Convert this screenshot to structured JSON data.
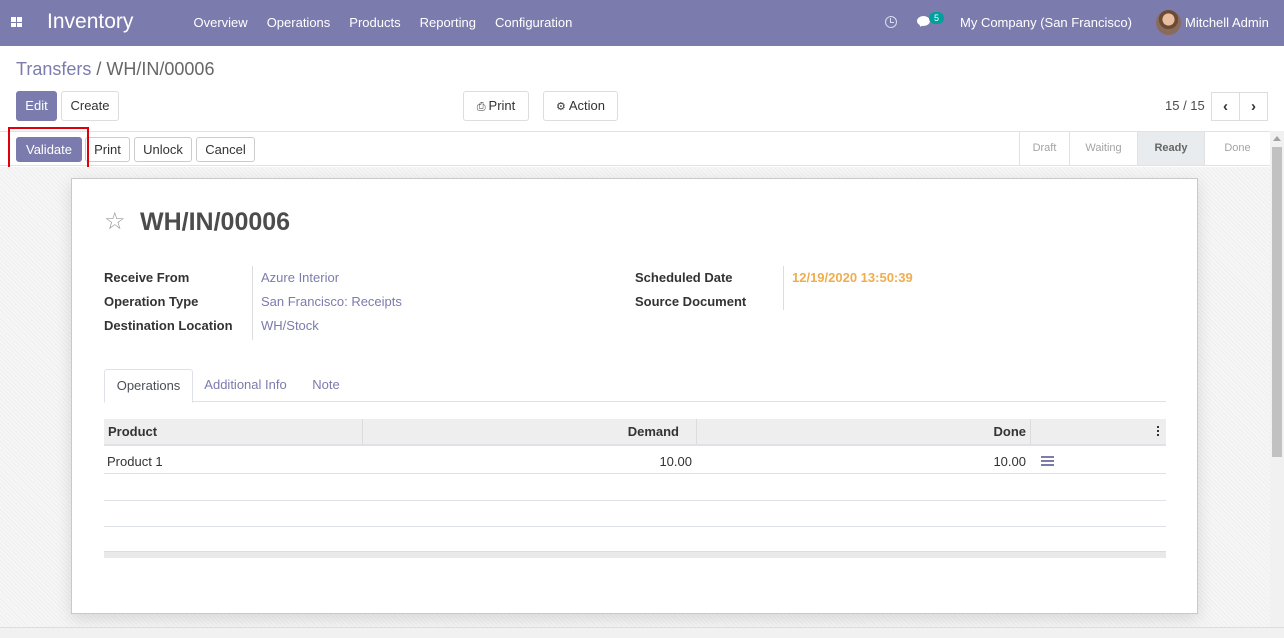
{
  "navbar": {
    "app_name": "Inventory",
    "menu": [
      "Overview",
      "Operations",
      "Products",
      "Reporting",
      "Configuration"
    ],
    "messages_badge": "5",
    "company": "My Company (San Francisco)",
    "user": "Mitchell Admin",
    "accent_color": "#7c7bad"
  },
  "breadcrumb": {
    "parent": "Transfers",
    "separator": "/",
    "current": "WH/IN/00006"
  },
  "control": {
    "edit_label": "Edit",
    "create_label": "Create",
    "print_label": "Print",
    "action_label": "Action",
    "pager": "15 / 15",
    "prev_icon": "chevron-left-icon",
    "next_icon": "chevron-right-icon"
  },
  "statusbar": {
    "buttons": [
      "Validate",
      "Print",
      "Unlock",
      "Cancel"
    ],
    "stages": [
      "Draft",
      "Waiting",
      "Ready",
      "Done"
    ],
    "active_stage": "Ready",
    "highlight_color": "#e0000b"
  },
  "form": {
    "title": "WH/IN/00006",
    "left_fields": [
      {
        "label": "Receive From",
        "value": "Azure Interior"
      },
      {
        "label": "Operation Type",
        "value": "San Francisco: Receipts"
      },
      {
        "label": "Destination Location",
        "value": "WH/Stock"
      }
    ],
    "right_fields": [
      {
        "label": "Scheduled Date",
        "value": "12/19/2020 13:50:39"
      },
      {
        "label": "Source Document",
        "value": ""
      }
    ],
    "tabs": [
      "Operations",
      "Additional Info",
      "Note"
    ],
    "active_tab": "Operations"
  },
  "operations_table": {
    "columns": [
      "Product",
      "Demand",
      "Done"
    ],
    "rows": [
      {
        "product": "Product 1",
        "demand": "10.00",
        "done": "10.00"
      }
    ]
  }
}
